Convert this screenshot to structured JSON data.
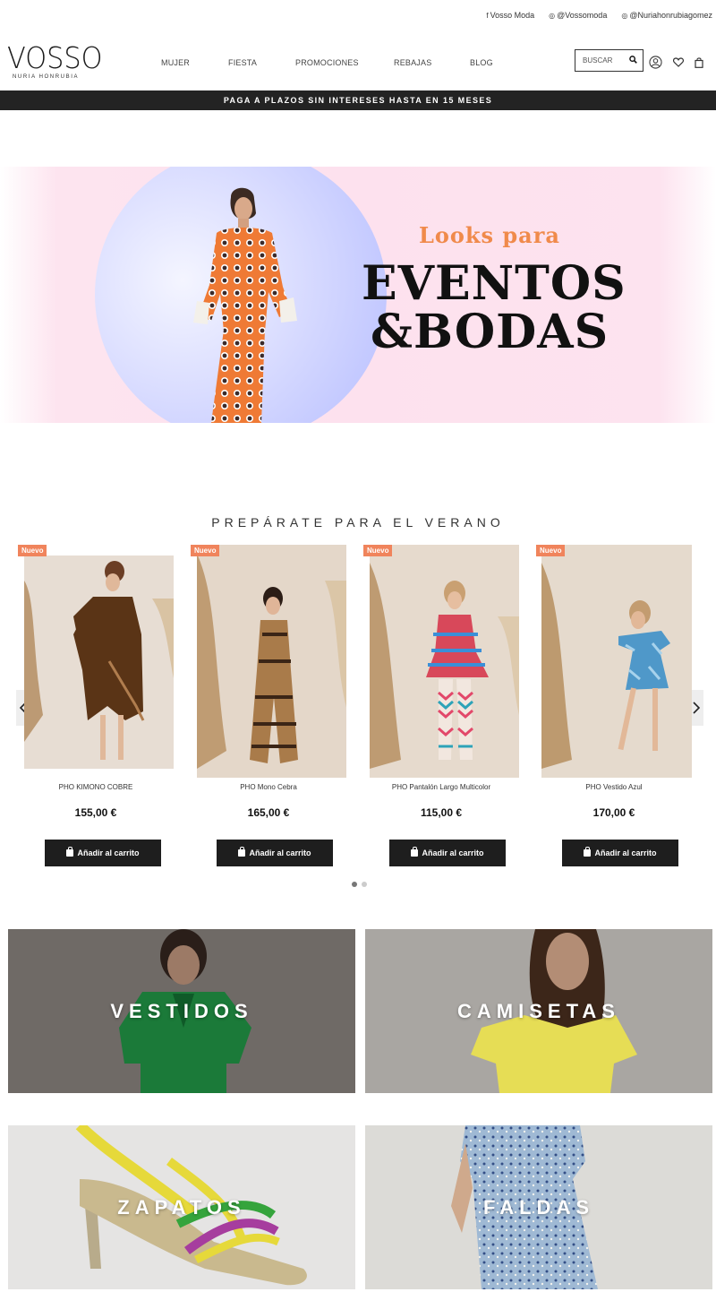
{
  "social": {
    "facebook": "Vosso Moda",
    "instagram1": "@Vossomoda",
    "instagram2": "@Nuriahonrubiagomez"
  },
  "logo": {
    "mark": "VOSSO",
    "sub": "NURIA HONRUBIA"
  },
  "nav": {
    "mujer": "MUJER",
    "fiesta": "FIESTA",
    "promociones": "PROMOCIONES",
    "rebajas": "REBAJAS",
    "blog": "BLOG"
  },
  "search": {
    "placeholder": "BUSCAR"
  },
  "promo_bar": "PAGA A PLAZOS SIN INTERESES HASTA EN 15 MESES",
  "hero": {
    "line1": "Looks para",
    "line2": "EVENTOS",
    "line3": "&BODAS"
  },
  "section_title": "PREPÁRATE PARA EL VERANO",
  "products": [
    {
      "badge": "Nuevo",
      "name": "PHO KIMONO COBRE",
      "price": "155,00 €",
      "button": "Añadir al carrito"
    },
    {
      "badge": "Nuevo",
      "name": "PHO Mono Cebra",
      "price": "165,00 €",
      "button": "Añadir al carrito"
    },
    {
      "badge": "Nuevo",
      "name": "PHO Pantalón Largo Multicolor",
      "price": "115,00 €",
      "button": "Añadir al carrito"
    },
    {
      "badge": "Nuevo",
      "name": "PHO Vestido Azul",
      "price": "170,00 €",
      "button": "Añadir al carrito"
    }
  ],
  "carousel": {
    "prev_icon": "chevron-left-icon",
    "next_icon": "chevron-right-icon",
    "pages": 2,
    "current": 1
  },
  "categories": {
    "vestidos": "VESTIDOS",
    "camisetas": "CAMISETAS",
    "zapatos": "ZAPATOS",
    "faldas": "FALDAS"
  },
  "colors": {
    "accent_orange": "#f08a4b",
    "badge": "#f0845c",
    "dark": "#1e1e1e"
  }
}
